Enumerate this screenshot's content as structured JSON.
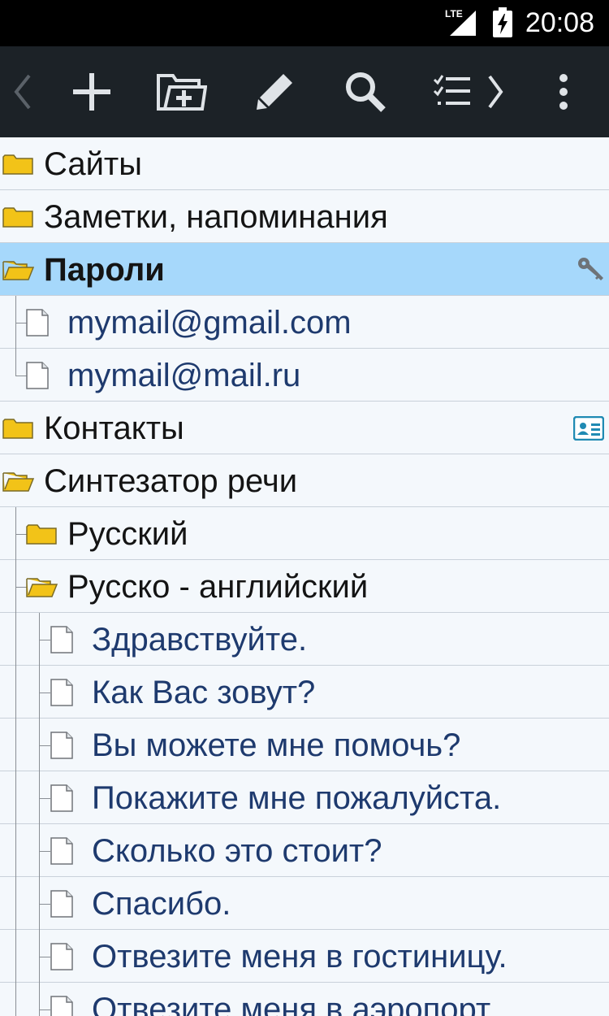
{
  "status": {
    "time": "20:08",
    "network": "LTE"
  },
  "toolbar": {
    "buttons": [
      {
        "name": "back-button",
        "icon": "chevron-left-icon"
      },
      {
        "name": "add-button",
        "icon": "plus-icon"
      },
      {
        "name": "add-folder-button",
        "icon": "folder-add-icon"
      },
      {
        "name": "edit-button",
        "icon": "pencil-icon"
      },
      {
        "name": "search-button",
        "icon": "search-icon"
      },
      {
        "name": "checklist-button",
        "icon": "checklist-icon"
      },
      {
        "name": "more-button",
        "icon": "more-vert-icon"
      }
    ]
  },
  "tree": {
    "items": [
      {
        "label": "Сайты",
        "type": "folder",
        "level": 0
      },
      {
        "label": "Заметки, напоминания",
        "type": "folder",
        "level": 0
      },
      {
        "label": "Пароли",
        "type": "folder-open",
        "level": 0,
        "selected": true,
        "badge": "key-icon"
      },
      {
        "label": "mymail@gmail.com",
        "type": "note",
        "level": 1
      },
      {
        "label": "mymail@mail.ru",
        "type": "note",
        "level": 1
      },
      {
        "label": "Контакты",
        "type": "folder",
        "level": 0,
        "badge": "contact-card-icon"
      },
      {
        "label": "Синтезатор речи",
        "type": "folder-open",
        "level": 0
      },
      {
        "label": "Русский",
        "type": "folder",
        "level": 1
      },
      {
        "label": "Русско - английский",
        "type": "folder-open",
        "level": 1
      },
      {
        "label": "Здравствуйте.",
        "type": "note",
        "level": 2
      },
      {
        "label": "Как Вас зовут?",
        "type": "note",
        "level": 2
      },
      {
        "label": "Вы можете мне помочь?",
        "type": "note",
        "level": 2
      },
      {
        "label": "Покажите мне пожалуйста.",
        "type": "note",
        "level": 2
      },
      {
        "label": "Сколько это стоит?",
        "type": "note",
        "level": 2
      },
      {
        "label": "Спасибо.",
        "type": "note",
        "level": 2
      },
      {
        "label": "Отвезите меня в гостиницу.",
        "type": "note",
        "level": 2
      },
      {
        "label": "Отвезите меня в аэропорт.",
        "type": "note",
        "level": 2
      }
    ]
  },
  "colors": {
    "toolbar": "#1c2227",
    "selected": "#a6d8fb",
    "folder": "#f2c318",
    "note_text": "#1e3a6e"
  }
}
